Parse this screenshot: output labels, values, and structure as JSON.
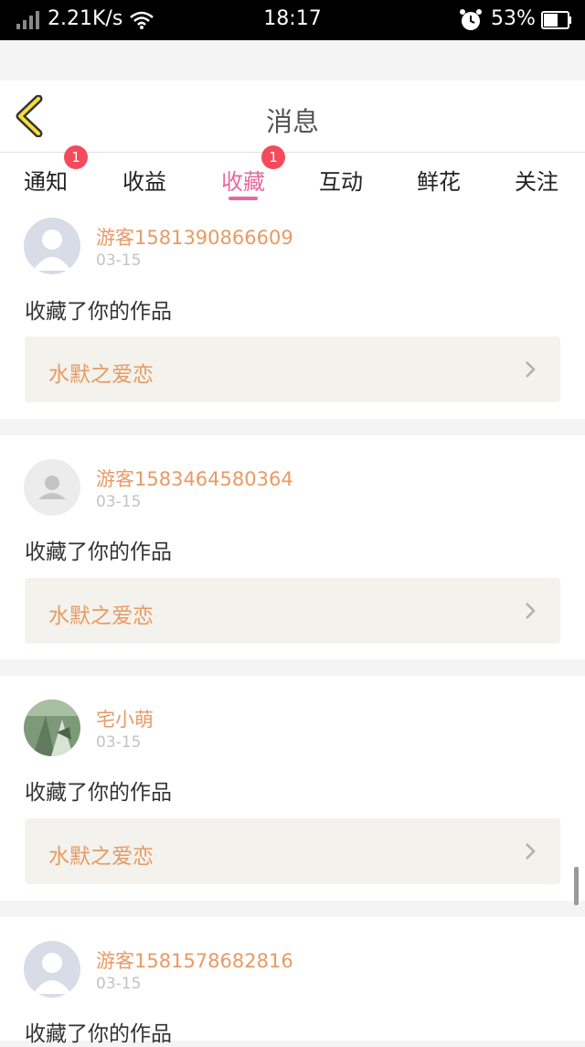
{
  "status_bar": {
    "speed": "2.21K/s",
    "time": "18:17",
    "battery": "53%"
  },
  "header": {
    "title": "消息"
  },
  "tabs": [
    {
      "label": "通知",
      "badge": "1",
      "active": false
    },
    {
      "label": "收益",
      "badge": "",
      "active": false
    },
    {
      "label": "收藏",
      "badge": "1",
      "active": true
    },
    {
      "label": "互动",
      "badge": "",
      "active": false
    },
    {
      "label": "鲜花",
      "badge": "",
      "active": false
    },
    {
      "label": "关注",
      "badge": "",
      "active": false
    }
  ],
  "messages": [
    {
      "user": "游客1581390866609",
      "date": "03-15",
      "action": "收藏了你的作品",
      "work": "水默之爱恋",
      "avatar": "default-avatar"
    },
    {
      "user": "游客1583464580364",
      "date": "03-15",
      "action": "收藏了你的作品",
      "work": "水默之爱恋",
      "avatar": "default-avatar"
    },
    {
      "user": "宅小萌",
      "date": "03-15",
      "action": "收藏了你的作品",
      "work": "水默之爱恋",
      "avatar": "photo-avatar"
    },
    {
      "user": "游客1581578682816",
      "date": "03-15",
      "action": "收藏了你的作品",
      "work": "",
      "avatar": "default-avatar"
    }
  ],
  "colors": {
    "accent": "#e46aa0",
    "username": "#e89a65",
    "badge": "#f34b5c",
    "work_bg": "#f3f2ec"
  }
}
